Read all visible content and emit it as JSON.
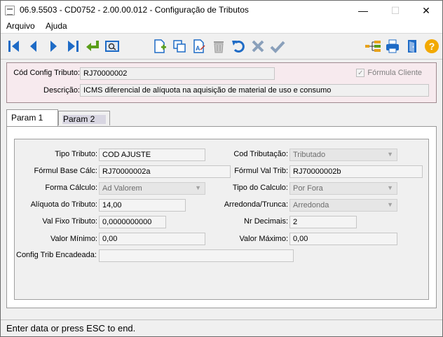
{
  "window": {
    "title": "06.9.5503 - CD0752 - 2.00.00.012 - Configuração de Tributos",
    "minimize": "—",
    "maximize": "☐",
    "close": "✕"
  },
  "menu": [
    {
      "label": "Arquivo"
    },
    {
      "label": "Ajuda"
    }
  ],
  "toolbar": {
    "icons": [
      "first-record-icon",
      "previous-record-icon",
      "next-record-icon",
      "last-record-icon",
      "return-icon",
      "search-icon",
      "new-record-icon",
      "copy-record-icon",
      "edit-text-icon",
      "delete-icon",
      "undo-icon",
      "cancel-icon",
      "confirm-icon",
      "tree-icon",
      "print-icon",
      "exit-icon",
      "help-icon"
    ]
  },
  "header": {
    "cod_config_label": "Cód Config Tributo:",
    "cod_config_value": "RJ70000002",
    "formula_cliente_label": "Fórmula Cliente",
    "formula_cliente_checked": true,
    "descricao_label": "Descrição:",
    "descricao_value": "ICMS diferencial de alíquota na aquisição de material de uso e consumo"
  },
  "tabs": [
    {
      "label": "Param 1",
      "active": true
    },
    {
      "label": "Param 2",
      "active": false
    }
  ],
  "param1": {
    "tipo_tributo_label": "Tipo Tributo:",
    "tipo_tributo_value": "COD AJUSTE",
    "cod_tributacao_label": "Cod Tributação:",
    "cod_tributacao_value": "Tributado",
    "formul_base_label": "Fórmul Base Cálc:",
    "formul_base_value": "RJ70000002a",
    "formul_val_label": "Fórmul Val Trib:",
    "formul_val_value": "RJ70000002b",
    "forma_calculo_label": "Forma Cálculo:",
    "forma_calculo_value": "Ad Valorem",
    "tipo_calculo_label": "Tipo do Calculo:",
    "tipo_calculo_value": "Por Fora",
    "aliquota_label": "Alíquota do Tributo:",
    "aliquota_value": "14,00",
    "arredonda_label": "Arredonda/Trunca:",
    "arredonda_value": "Arredonda",
    "val_fixo_label": "Val Fixo Tributo:",
    "val_fixo_value": "0,0000000000",
    "nr_decimais_label": "Nr Decimais:",
    "nr_decimais_value": "2",
    "valor_minimo_label": "Valor Mínimo:",
    "valor_minimo_value": "0,00",
    "valor_maximo_label": "Valor Máximo:",
    "valor_maximo_value": "0,00",
    "config_encadeada_label": "Config Trib Encadeada:",
    "config_encadeada_value": ""
  },
  "status": {
    "text": "Enter data or press ESC to end."
  }
}
